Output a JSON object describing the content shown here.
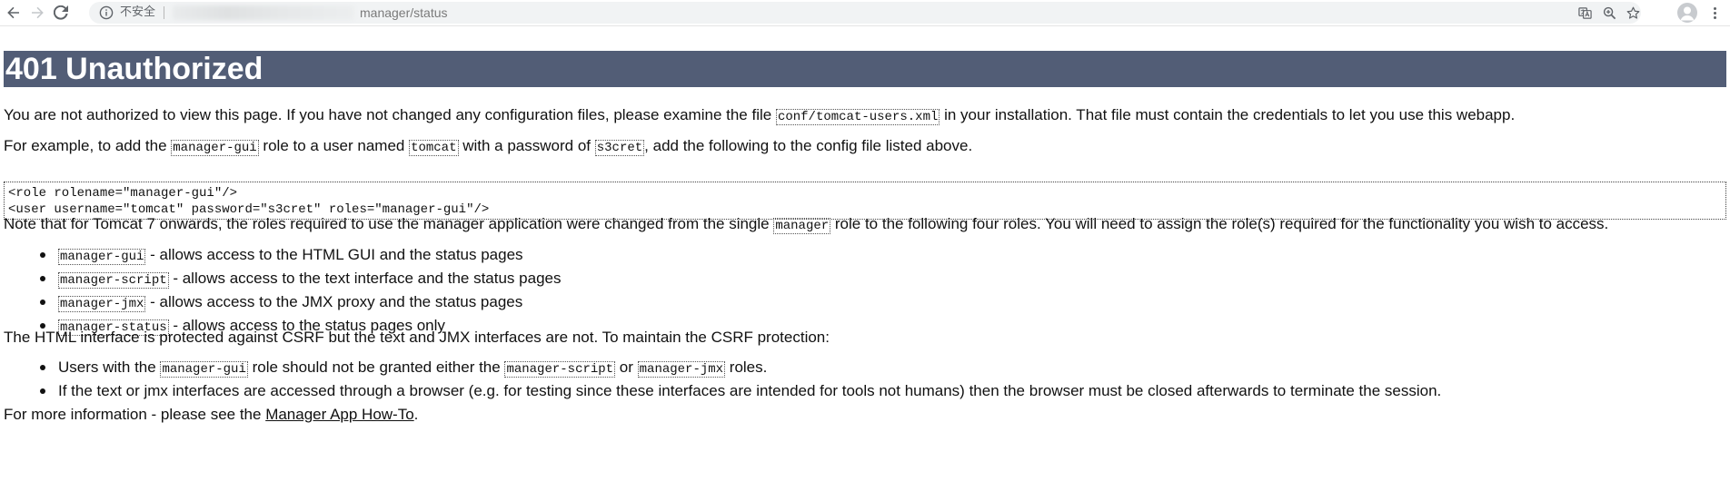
{
  "browser": {
    "insecure_label": "不安全",
    "url": "manager/status"
  },
  "page": {
    "title": "401 Unauthorized",
    "intro": {
      "before": "You are not authorized to view this page. If you have not changed any configuration files, please examine the file ",
      "file": "conf/tomcat-users.xml",
      "after": " in your installation. That file must contain the credentials to let you use this webapp."
    },
    "example": {
      "t1": "For example, to add the ",
      "role": "manager-gui",
      "t2": " role to a user named ",
      "user": "tomcat",
      "t3": " with a password of ",
      "password": "s3cret",
      "t4": ", add the following to the config file listed above."
    },
    "config_lines": [
      "<role rolename=\"manager-gui\"/>",
      "<user username=\"tomcat\" password=\"s3cret\" roles=\"manager-gui\"/>"
    ],
    "note": {
      "before": "Note that for Tomcat 7 onwards, the roles required to use the manager application were changed from the single ",
      "role": "manager",
      "after": " role to the following four roles. You will need to assign the role(s) required for the functionality you wish to access."
    },
    "roles": [
      {
        "code": "manager-gui",
        "desc": " - allows access to the HTML GUI and the status pages"
      },
      {
        "code": "manager-script",
        "desc": " - allows access to the text interface and the status pages"
      },
      {
        "code": "manager-jmx",
        "desc": " - allows access to the JMX proxy and the status pages"
      },
      {
        "code": "manager-status",
        "desc": " - allows access to the status pages only"
      }
    ],
    "csrf_intro": "The HTML interface is protected against CSRF but the text and JMX interfaces are not. To maintain the CSRF protection:",
    "csrf_item1": {
      "t1": "Users with the ",
      "c1": "manager-gui",
      "t2": " role should not be granted either the ",
      "c2": "manager-script",
      "t3": " or ",
      "c3": "manager-jmx",
      "t4": " roles."
    },
    "csrf_item2": "If the text or jmx interfaces are accessed through a browser (e.g. for testing since these interfaces are intended for tools not humans) then the browser must be closed afterwards to terminate the session.",
    "more_info": {
      "before": "For more information - please see the ",
      "link": "Manager App How-To",
      "after": "."
    }
  }
}
